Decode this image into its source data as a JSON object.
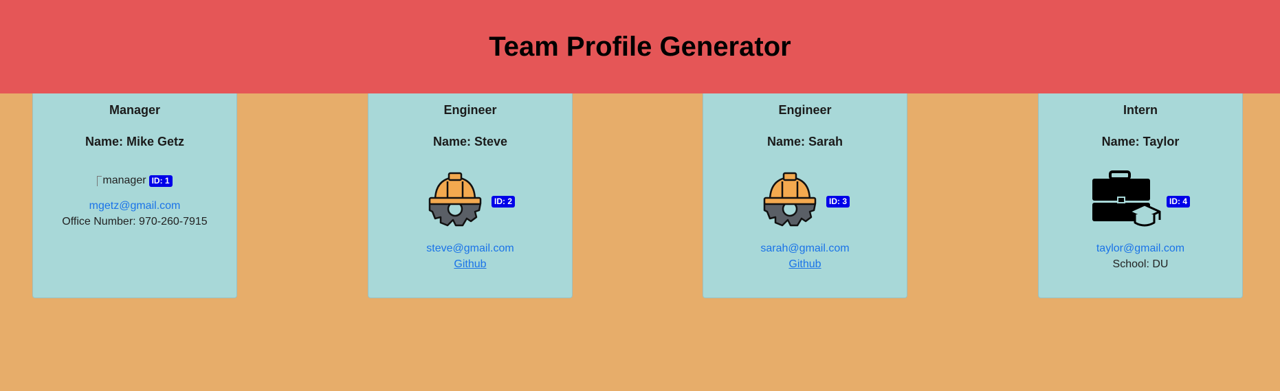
{
  "header": {
    "title": "Team Profile Generator"
  },
  "cards": [
    {
      "role": "Manager",
      "name": "Name: Mike Getz",
      "image_alt": "manager",
      "badge": "ID: 1",
      "email": "mgetz@gmail.com",
      "extra": "Office Number: 970-260-7915"
    },
    {
      "role": "Engineer",
      "name": "Name: Steve",
      "icon": "engineer-helmet-gear-icon",
      "badge": "ID: 2",
      "email": "steve@gmail.com",
      "link": "Github"
    },
    {
      "role": "Engineer",
      "name": "Name: Sarah",
      "icon": "engineer-helmet-gear-icon",
      "badge": "ID: 3",
      "email": "sarah@gmail.com",
      "link": "Github"
    },
    {
      "role": "Intern",
      "name": "Name: Taylor",
      "icon": "intern-briefcase-grad-cap-icon",
      "badge": "ID: 4",
      "email": "taylor@gmail.com",
      "extra": "School: DU"
    }
  ],
  "colors": {
    "header_bg": "#e55657",
    "page_bg": "#e7ad6a",
    "card_bg": "#a8d8d8",
    "badge_bg": "#0000e8",
    "link": "#1a73e8"
  }
}
